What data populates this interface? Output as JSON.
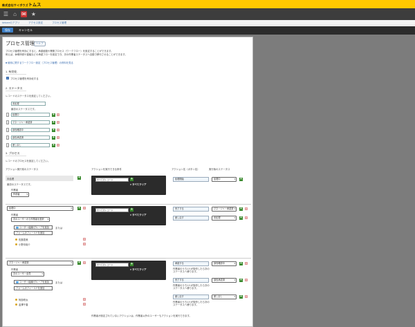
{
  "header": {
    "brand_small": "株式会社サイボウズ",
    "brand": "トムス"
  },
  "breadcrumb": [
    "kintoneのアプリ",
    "アクセス設定",
    "プロセス管理"
  ],
  "actions": {
    "save": "保存",
    "cancel": "キャンセル"
  },
  "page": {
    "title": "プロセス管理",
    "help": "ヘルプ",
    "desc1": "プロセス管理を有効にすると、承認経路や業務プロセス（ワークフロー）を設定することができます。",
    "desc2": "例えば、休暇申請や稟議などの承認フローを設定でき、次の作業者ステータスへ自動で移行させることができます。",
    "link": "■ 使用に関するワークフロー設定（プロセス管理）の資料を見る"
  },
  "sec1": {
    "title": "1. 有効化",
    "checkbox": "プロセス管理を有効化する"
  },
  "sec2": {
    "title": "2. ステータス",
    "desc": "レコードのステータスを設定してください。",
    "status_input": "未処理",
    "status_note": "最初のステータスです。",
    "statuses": [
      "処理中",
      "マネージャー承認済",
      "部長確認中",
      "部長承認済",
      "差し戻し"
    ]
  },
  "sec3": {
    "title": "3. プロセス",
    "desc": "レコードのプロセスを設定してください。",
    "col_status": "アクション実行前のステータス",
    "col_cond": "アクションを実行できる条件",
    "col_action": "アクション名（ボタン名）",
    "col_next": "実行後のステータス",
    "p1": {
      "status": "未処理",
      "note": "最初のステータスです。",
      "assignee_label": "作業者",
      "assignee": "作成者",
      "cond": "すべてのレコード",
      "clear": "すべてクリア",
      "action": "処理開始",
      "next": "処理中"
    },
    "p2": {
      "status": "処理中",
      "assignee_label": "作業者",
      "assignee": "次のユーザーから作業者を選択",
      "btn_user": "ユーザー/組織/グループを追加",
      "or": "または",
      "btn_field": "フォームのフィールドを追加",
      "u1": "佐藤恵美",
      "u2": "小野寺裕介",
      "cond": "すべてのレコード",
      "clear": "すべてクリア",
      "a1": "完了する",
      "n1": "マネージャー承認済",
      "a2": "差し戻す",
      "n2": "未処理"
    },
    "p3": {
      "status": "マネージャー承認済",
      "assignee_label": "作業者",
      "assignee": "次のユーザー全員",
      "btn_user": "ユーザー/組織/グループを追加",
      "or": "または",
      "btn_field": "フォームのフィールドを追加",
      "u1": "阿部修太",
      "u2": "金澤千春",
      "cond": "すべてのレコード",
      "clear": "すべてクリア",
      "a1": "承認する",
      "n1": "部長確認中",
      "a1_note": "作業者のうち1人が操作したら次のステータスへ移ります。",
      "a2": "完了する",
      "n2": "部長承認済",
      "a2_note": "作業者のうち1人が操作したら次のステータスへ移ります。",
      "a3": "差し戻す",
      "n3": "差し戻し",
      "a3_note": "作業者のうち1人が操作したら次のステータスへ移ります。"
    },
    "footer_note": "作業者が設定されていないアクションは、作業者以外のユーザーもアクションを実行できます。"
  }
}
